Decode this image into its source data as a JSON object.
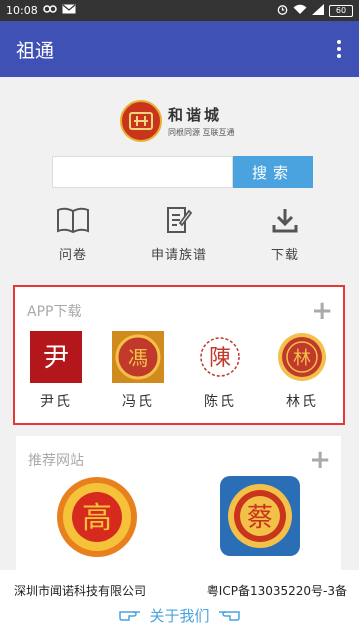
{
  "statusbar": {
    "time": "10:08",
    "battery": "60"
  },
  "appbar": {
    "title": "祖通"
  },
  "logo": {
    "main_text": "和谐城",
    "sub_text": "同根同源 互联互通"
  },
  "search": {
    "placeholder": "",
    "value": "",
    "button_label": "搜索"
  },
  "quick_links": [
    {
      "label": "问卷",
      "icon": "book-icon"
    },
    {
      "label": "申请族谱",
      "icon": "edit-document-icon"
    },
    {
      "label": "下载",
      "icon": "download-icon"
    }
  ],
  "app_section": {
    "title": "APP下载",
    "apps": [
      {
        "label": "尹氏",
        "icon": "yin-clan-icon",
        "icon_char": "尹"
      },
      {
        "label": "冯氏",
        "icon": "feng-clan-icon",
        "icon_char": "馮"
      },
      {
        "label": "陈氏",
        "icon": "chen-clan-icon",
        "icon_char": "陳"
      },
      {
        "label": "林氏",
        "icon": "lin-clan-icon",
        "icon_char": "林"
      }
    ]
  },
  "site_section": {
    "title": "推荐网站",
    "sites": [
      {
        "icon": "site-gao-logo",
        "icon_char": "高"
      },
      {
        "icon": "site-cai-logo",
        "icon_char": "蔡"
      }
    ]
  },
  "footer": {
    "company": "深圳市闻诺科技有限公司",
    "icp": "粤ICP备13035220号-3备",
    "about": "关于我们"
  },
  "colors": {
    "appbar": "#3f51b5",
    "accent": "#4aa3df",
    "highlight": "#e53935"
  }
}
